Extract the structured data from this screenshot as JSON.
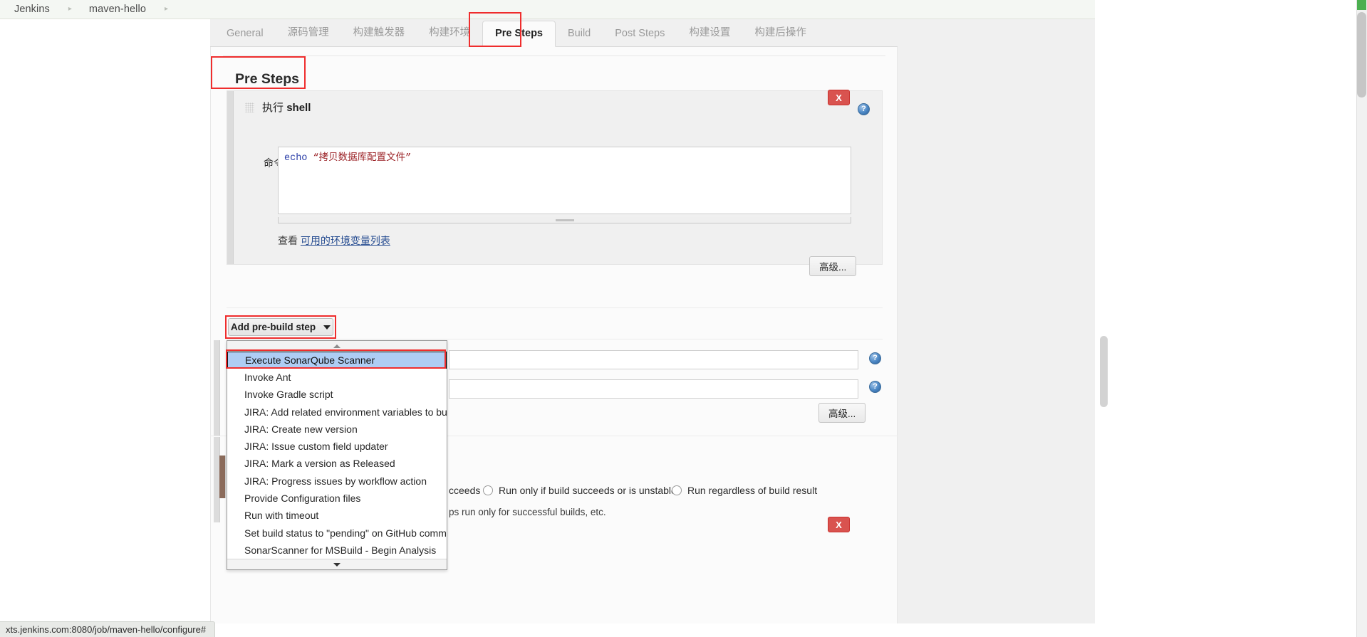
{
  "breadcrumb": {
    "items": [
      "Jenkins",
      "maven-hello"
    ],
    "separator": "▸"
  },
  "tabs": [
    {
      "label": "General",
      "active": false
    },
    {
      "label": "源码管理",
      "active": false
    },
    {
      "label": "构建触发器",
      "active": false
    },
    {
      "label": "构建环境",
      "active": false
    },
    {
      "label": "Pre Steps",
      "active": true
    },
    {
      "label": "Build",
      "active": false
    },
    {
      "label": "Post Steps",
      "active": false
    },
    {
      "label": "构建设置",
      "active": false
    },
    {
      "label": "构建后操作",
      "active": false
    }
  ],
  "section": {
    "title": "Pre Steps"
  },
  "builder": {
    "title_cjk": "执行",
    "title_en": "shell",
    "delete_label": "X",
    "help_label": "?",
    "command_label": "命令",
    "command_token": "echo",
    "command_string": "“拷贝数据库配置文件”",
    "env_prefix": "查看",
    "env_link": "可用的环境变量列表",
    "advanced_label": "高级..."
  },
  "add_step": {
    "label": "Add pre-build step"
  },
  "dropdown": {
    "scroll_up": "▲",
    "scroll_down": "▼",
    "items": [
      {
        "label": "Execute SonarQube Scanner",
        "selected": true
      },
      {
        "label": "Invoke Ant",
        "selected": false
      },
      {
        "label": "Invoke Gradle script",
        "selected": false
      },
      {
        "label": "JIRA: Add related environment variables to build",
        "selected": false
      },
      {
        "label": "JIRA: Create new version",
        "selected": false
      },
      {
        "label": "JIRA: Issue custom field updater",
        "selected": false
      },
      {
        "label": "JIRA: Mark a version as Released",
        "selected": false
      },
      {
        "label": "JIRA: Progress issues by workflow action",
        "selected": false
      },
      {
        "label": "Provide Configuration files",
        "selected": false
      },
      {
        "label": "Run with timeout",
        "selected": false
      },
      {
        "label": "Set build status to \"pending\" on GitHub commit",
        "selected": false
      },
      {
        "label": "SonarScanner for MSBuild - Begin Analysis",
        "selected": false
      }
    ]
  },
  "background_form": {
    "advanced_label": "高级...",
    "help_label": "?",
    "radio_options": [
      {
        "label": "cceeds"
      },
      {
        "label": "Run only if build succeeds or is unstable"
      },
      {
        "label": "Run regardless of build result"
      }
    ],
    "helper_text": "ps run only for successful builds, etc.",
    "delete_label": "X"
  },
  "statusbar": {
    "url": "xts.jenkins.com:8080/job/maven-hello/configure#"
  },
  "colors": {
    "highlight_box": "#ef2d2d",
    "selected_item": "#aecdf4",
    "delete_button": "#d9534f",
    "link": "#264c91",
    "command_token": "#2b3ea8",
    "command_string": "#9b2226"
  }
}
